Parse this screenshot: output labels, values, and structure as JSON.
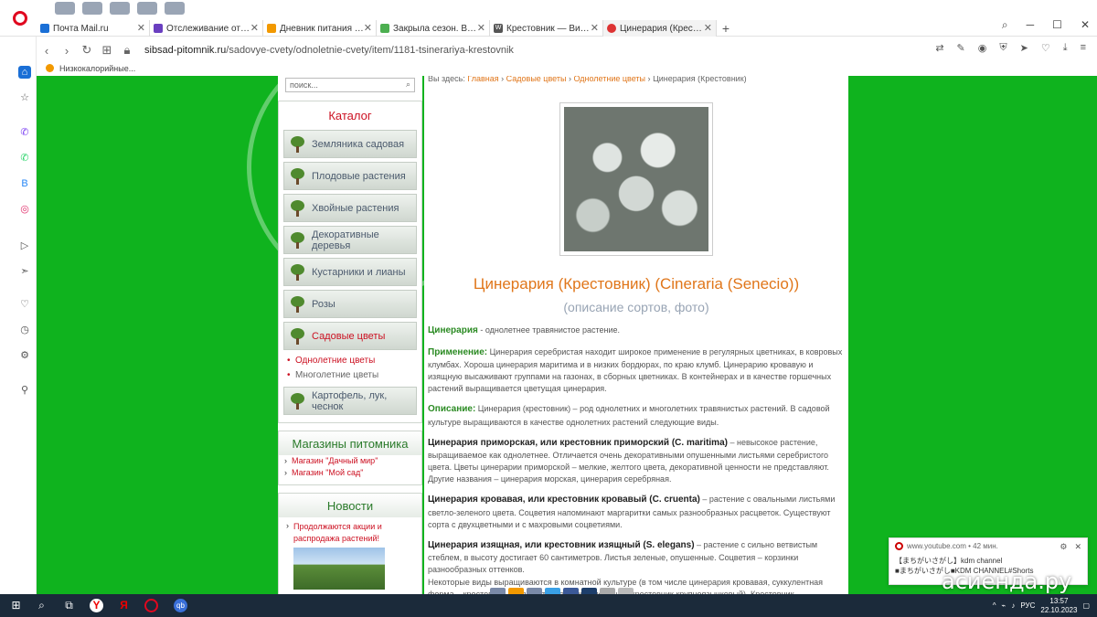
{
  "browser": {
    "tabs": [
      {
        "title": "Почта Mail.ru",
        "color": "#1a6fd6"
      },
      {
        "title": "Отслеживание отправлен",
        "color": "#6a3fc0"
      },
      {
        "title": "Дневник питания - на Die",
        "color": "#f29900"
      },
      {
        "title": "Закрыла сезон. Выводы и",
        "color": "#4caf50"
      },
      {
        "title": "Крестовник — Википедия",
        "color": "#555555"
      },
      {
        "title": "Цинерария (Крестовник)",
        "color": "#d33"
      }
    ],
    "new_tab": "+",
    "url_domain": "sibsad-pitomnik.ru",
    "url_path": "/sadovye-cvety/odnoletnie-cvety/item/1181-tsinerariya-krestovnik",
    "bookmark": "Низкокалорийные..."
  },
  "page": {
    "search_placeholder": "поиск...",
    "catalog_title": "Каталог",
    "catalog_items": [
      "Земляника садовая",
      "Плодовые растения",
      "Хвойные растения",
      "Декоративные деревья",
      "Кустарники и лианы",
      "Розы",
      "Садовые цветы",
      "Картофель, лук, чеснок"
    ],
    "sub_items": [
      "Однолетние цветы",
      "Многолетние цветы"
    ],
    "shops_title": "Магазины питомника",
    "shops": [
      "Магазин \"Дачный мир\"",
      "Магазин \"Мой сад\""
    ],
    "news_title": "Новости",
    "news_item": "Продолжаются акции и распродажа растений!",
    "breadcrumb": {
      "prefix": "Вы здесь:",
      "home": "Главная",
      "sep": "›",
      "section": "Садовые цветы",
      "subsection": "Однолетние цветы",
      "current": "Цинерария (Крестовник)"
    },
    "heading": "Цинерария (Крестовник) (Cineraria (Senecio))",
    "subheading": "(описание сортов, фото)",
    "p1_label": "Цинерария",
    "p1_text": " - однолетнее травянистое растение.",
    "p2_label": "Применение:",
    "p2_text": " Цинерария серебристая находит широкое применение в регулярных цветниках, в ковровых клумбах. Хороша цинерария маритима и в низких бордюрах, по краю клумб. Цинерарию кровавую и изящную высаживают группами на газонах, в сборных цветниках. В контейнерах и в качестве горшечных растений выращивается цветущая цинерария.",
    "p3_label": "Описание:",
    "p3_text": " Цинерария (крестовник) – род однолетних и многолетних травянистых растений. В садовой культуре выращиваются в качестве однолетних растений следующие виды.",
    "p4_label": "Цинерария приморская, или крестовник приморский (C. maritima)",
    "p4_text": " – невысокое растение, выращиваемое как однолетнее. Отличается очень декоративными опушенными листьями серебристого цвета. Цветы цинерарии приморской – мелкие, желтого цвета, декоративной ценности не представляют. Другие названия – цинерария морская, цинерария серебряная.",
    "p5_label": "Цинерария кровавая, или крестовник кровавый (C. cruenta)",
    "p5_text": " – растение с овальными листьями светло-зеленого цвета. Соцветия напоминают маргаритки самых разнообразных расцветок. Существуют сорта с двухцветными и с махровыми соцветиями.",
    "p6_label": "Цинерария изящная, или крестовник изящный (S. elegans)",
    "p6_text": " – растение с сильно ветвистым стеблем, в высоту достигает 60 сантиметров. Листья зеленые, опушенные. Соцветия – корзинки разнообразных оттенков.",
    "p7_text": "Некоторые виды выращиваются в комнатной культуре (в том числе цинерария кровавая, суккулентная форма – крестовник Роули, а также принадлежащий крестовник крупноязычковый). Крестовник плоскостилый,"
  },
  "notification": {
    "source": "www.youtube.com • 42 мин.",
    "line1": "【まちがいさがし】kdm channel",
    "line2": "■まちがいさがし■KDM CHANNEL#Shorts"
  },
  "watermark": "асиенда.ру",
  "taskbar": {
    "lang": "РУС",
    "time": "13:57",
    "date": "22.10.2023"
  }
}
